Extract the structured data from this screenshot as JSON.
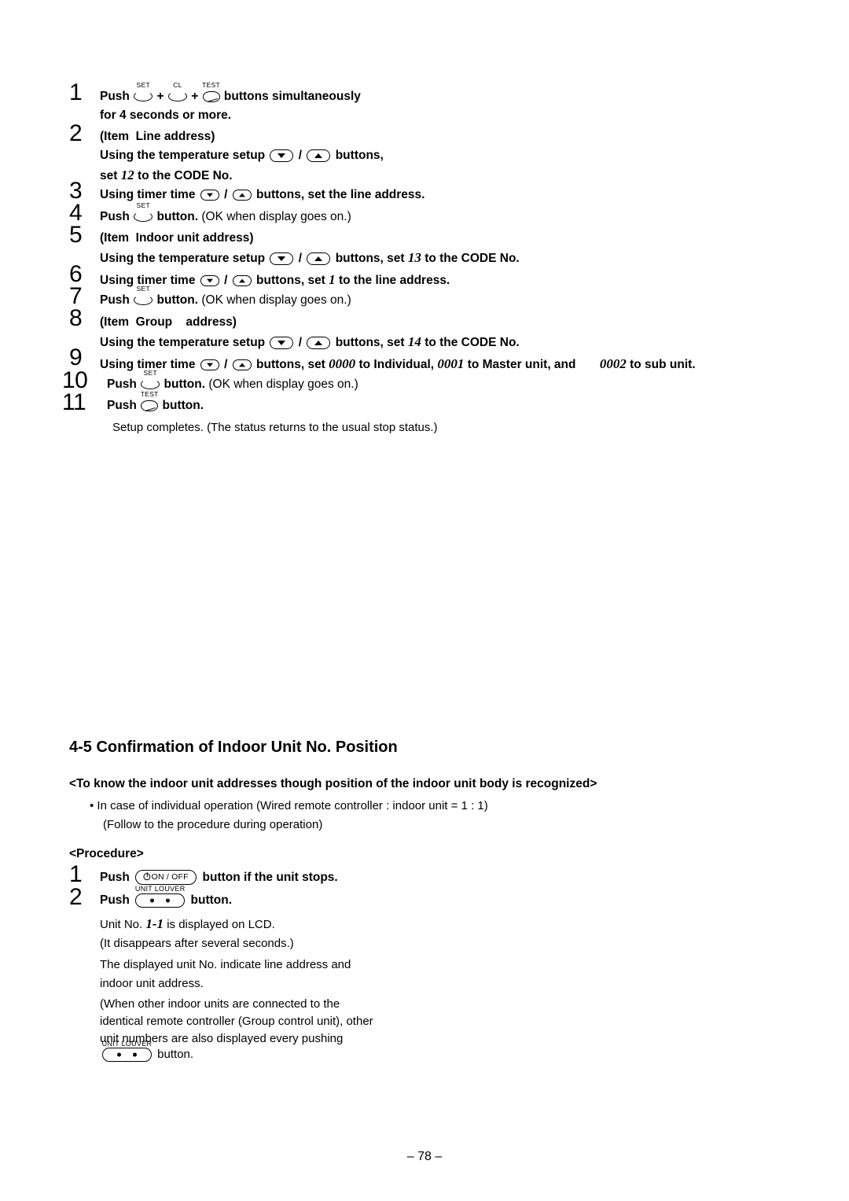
{
  "page": {
    "footer": "– 78 –"
  },
  "icons": {
    "set": "SET",
    "cl": "CL",
    "test": "TEST",
    "unit_louver": "UNIT LOUVER",
    "on_off": "ON / OFF"
  },
  "steps": [
    {
      "num": "1",
      "lines": [
        {
          "parts": [
            {
              "t": "text",
              "v": "Push ",
              "bold": true
            },
            {
              "t": "btn",
              "v": "set-button"
            },
            {
              "t": "text",
              "v": " + ",
              "bold": true
            },
            {
              "t": "btn",
              "v": "cl-button"
            },
            {
              "t": "text",
              "v": " + ",
              "bold": true
            },
            {
              "t": "btn",
              "v": "test-button"
            },
            {
              "t": "text",
              "v": " buttons simultaneously",
              "bold": true
            }
          ]
        },
        {
          "parts": [
            {
              "t": "text",
              "v": "for 4 seconds or more.",
              "bold": true
            }
          ]
        }
      ]
    },
    {
      "num": "2",
      "lines": [
        {
          "parts": [
            {
              "t": "text",
              "v": "(Item Line address)",
              "bold": true
            }
          ]
        },
        {
          "parts": [
            {
              "t": "text",
              "v": "Using the temperature setup ",
              "bold": true
            },
            {
              "t": "btn",
              "v": "temp-down-button"
            },
            {
              "t": "text",
              "v": " / ",
              "bold": true
            },
            {
              "t": "btn",
              "v": "temp-up-button"
            },
            {
              "t": "text",
              "v": " buttons,",
              "bold": true
            }
          ]
        },
        {
          "parts": [
            {
              "t": "text",
              "v": "set ",
              "bold": true
            },
            {
              "t": "ital",
              "v": "12"
            },
            {
              "t": "text",
              "v": " to the CODE No.",
              "bold": true
            }
          ]
        }
      ]
    },
    {
      "num": "3",
      "lines": [
        {
          "parts": [
            {
              "t": "text",
              "v": "Using timer time ",
              "bold": true
            },
            {
              "t": "btn",
              "v": "timer-down-button"
            },
            {
              "t": "text",
              "v": " / ",
              "bold": true
            },
            {
              "t": "btn",
              "v": "timer-up-button"
            },
            {
              "t": "text",
              "v": " buttons, set the line address.",
              "bold": true
            }
          ]
        }
      ]
    },
    {
      "num": "4",
      "lines": [
        {
          "parts": [
            {
              "t": "text",
              "v": "Push ",
              "bold": true
            },
            {
              "t": "btn",
              "v": "set-button"
            },
            {
              "t": "text",
              "v": " button. ",
              "bold": true
            },
            {
              "t": "text",
              "v": "(OK when display goes on.)",
              "bold": false
            }
          ]
        }
      ]
    },
    {
      "num": "5",
      "lines": [
        {
          "parts": [
            {
              "t": "text",
              "v": "(Item Indoor unit address)",
              "bold": true
            }
          ]
        },
        {
          "parts": [
            {
              "t": "text",
              "v": "Using the temperature setup ",
              "bold": true
            },
            {
              "t": "btn",
              "v": "temp-down-button"
            },
            {
              "t": "text",
              "v": " / ",
              "bold": true
            },
            {
              "t": "btn",
              "v": "temp-up-button"
            },
            {
              "t": "text",
              "v": " buttons, set ",
              "bold": true
            },
            {
              "t": "ital",
              "v": "13"
            },
            {
              "t": "text",
              "v": " to the CODE No.",
              "bold": true
            }
          ]
        }
      ]
    },
    {
      "num": "6",
      "lines": [
        {
          "parts": [
            {
              "t": "text",
              "v": "Using timer time ",
              "bold": true
            },
            {
              "t": "btn",
              "v": "timer-down-button"
            },
            {
              "t": "text",
              "v": " / ",
              "bold": true
            },
            {
              "t": "btn",
              "v": "timer-up-button"
            },
            {
              "t": "text",
              "v": " buttons, set ",
              "bold": true
            },
            {
              "t": "ital",
              "v": "1"
            },
            {
              "t": "text",
              "v": " to the line address.",
              "bold": true
            }
          ]
        }
      ]
    },
    {
      "num": "7",
      "lines": [
        {
          "parts": [
            {
              "t": "text",
              "v": "Push ",
              "bold": true
            },
            {
              "t": "btn",
              "v": "set-button"
            },
            {
              "t": "text",
              "v": " button. ",
              "bold": true
            },
            {
              "t": "text",
              "v": "(OK when display goes on.)",
              "bold": false
            }
          ]
        }
      ]
    },
    {
      "num": "8",
      "lines": [
        {
          "parts": [
            {
              "t": "text",
              "v": "(Item Group    address)",
              "bold": true
            }
          ]
        },
        {
          "parts": [
            {
              "t": "text",
              "v": "Using the temperature setup ",
              "bold": true
            },
            {
              "t": "btn",
              "v": "temp-down-button"
            },
            {
              "t": "text",
              "v": " / ",
              "bold": true
            },
            {
              "t": "btn",
              "v": "temp-up-button"
            },
            {
              "t": "text",
              "v": " buttons, set ",
              "bold": true
            },
            {
              "t": "ital",
              "v": "14"
            },
            {
              "t": "text",
              "v": " to the CODE No.",
              "bold": true
            }
          ]
        }
      ]
    },
    {
      "num": "9",
      "lines": [
        {
          "parts": [
            {
              "t": "text",
              "v": "Using timer time ",
              "bold": true
            },
            {
              "t": "btn",
              "v": "timer-down-button"
            },
            {
              "t": "text",
              "v": " / ",
              "bold": true
            },
            {
              "t": "btn",
              "v": "timer-up-button"
            },
            {
              "t": "text",
              "v": " buttons, set ",
              "bold": true
            },
            {
              "t": "ital",
              "v": "0000"
            },
            {
              "t": "text",
              "v": " to Individual, ",
              "bold": true
            },
            {
              "t": "ital",
              "v": "0001"
            },
            {
              "t": "text",
              "v": " to Master unit, and ",
              "bold": true
            },
            {
              "t": "ital",
              "v": "0002"
            },
            {
              "t": "text",
              "v": " to sub unit.",
              "bold": true
            }
          ]
        }
      ]
    },
    {
      "num": "10",
      "lines": [
        {
          "parts": [
            {
              "t": "text",
              "v": "Push ",
              "bold": true
            },
            {
              "t": "btn",
              "v": "set-button"
            },
            {
              "t": "text",
              "v": " button. ",
              "bold": true
            },
            {
              "t": "text",
              "v": "(OK when display goes on.)",
              "bold": false
            }
          ]
        }
      ]
    },
    {
      "num": "11",
      "lines": [
        {
          "parts": [
            {
              "t": "text",
              "v": "Push ",
              "bold": true
            },
            {
              "t": "btn",
              "v": "test-button"
            },
            {
              "t": "text",
              "v": " button.",
              "bold": true
            }
          ]
        }
      ]
    }
  ],
  "after_steps_note": "Setup completes. (The status returns to the usual stop status.)",
  "section": {
    "heading": "4-5 Confirmation of Indoor Unit No. Position",
    "subheading": "<To know the indoor unit addresses though position of the indoor unit body is recognized>",
    "bullet1": "• In case of individual operation (Wired remote controller : indoor unit = 1 : 1)",
    "bullet1b": "(Follow to the procedure during operation)",
    "procedure_label": "<Procedure>"
  },
  "procedure": {
    "step1": {
      "num": "1",
      "prefix": "Push",
      "suffix": "button if the unit stops."
    },
    "step2": {
      "num": "2",
      "prefix": "Push",
      "suffix": "button."
    },
    "body": [
      {
        "pre": "Unit No. ",
        "ital": "1-1",
        "post": " is displayed on LCD."
      },
      {
        "pre": "(It disappears after several seconds.)",
        "ital": "",
        "post": ""
      },
      {
        "pre": "The displayed unit No. indicate line address and",
        "ital": "",
        "post": ""
      },
      {
        "pre": "indoor unit address.",
        "ital": "",
        "post": ""
      },
      {
        "pre": "(When other indoor units are connected to the",
        "ital": "",
        "post": ""
      },
      {
        "pre": "identical remote controller (Group control unit), other",
        "ital": "",
        "post": ""
      },
      {
        "pre": "unit numbers are also displayed every pushing",
        "ital": "",
        "post": ""
      }
    ],
    "tail": "button."
  }
}
